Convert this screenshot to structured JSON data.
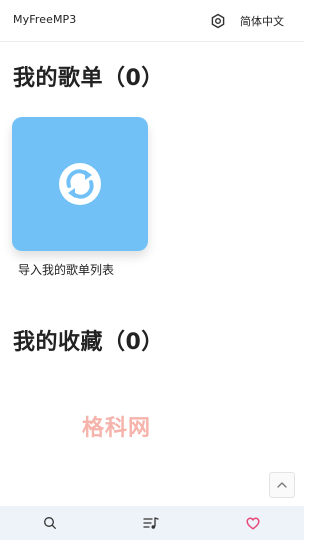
{
  "header": {
    "app_title": "MyFreeMP3",
    "language": "简体中文",
    "settings_icon": "gear-hexagon-icon"
  },
  "playlists": {
    "title": "我的歌单（0）",
    "import_card": {
      "icon": "sync-arrows-icon",
      "label": "导入我的歌单列表",
      "color": "#71c1f7"
    }
  },
  "favorites": {
    "title": "我的收藏（0）"
  },
  "watermark": "格科网",
  "scroll_top_icon": "chevron-up-icon",
  "bottom_nav": {
    "items": [
      {
        "name": "search",
        "icon": "search-icon"
      },
      {
        "name": "playlist",
        "icon": "music-list-icon"
      },
      {
        "name": "favorite",
        "icon": "heart-icon",
        "active": true,
        "color": "#e64a7a"
      }
    ]
  }
}
